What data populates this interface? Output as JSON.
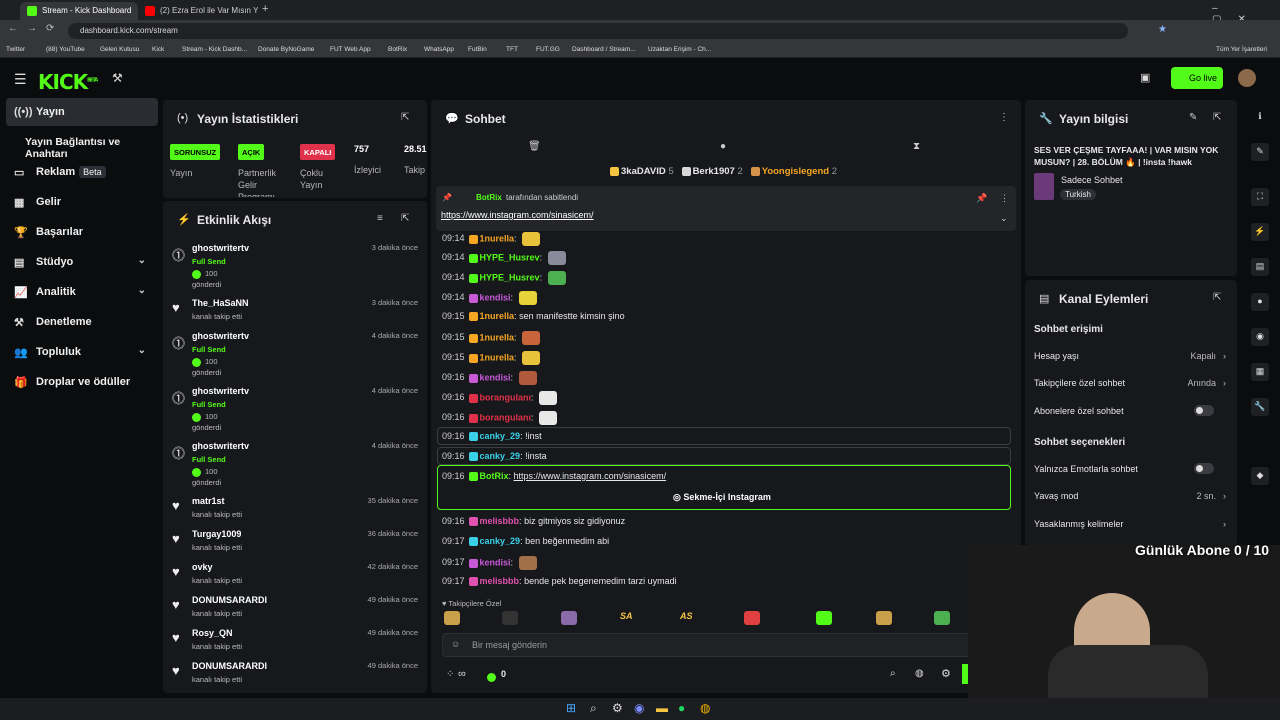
{
  "browser": {
    "tabs": [
      {
        "title": "Stream - Kick Dashboard",
        "active": true
      },
      {
        "title": "(2) Ezra Erol ile Var Mısın Yok M",
        "active": false
      }
    ],
    "url": "dashboard.kick.com/stream",
    "bookmarks": [
      "Twitter",
      "(88) YouTube",
      "Gelen Kutusu",
      "Kick",
      "Stream - Kick Dashb...",
      "Donate ByNoGame",
      "FUT Web App",
      "BotRix",
      "WhatsApp",
      "FutBin",
      "TFT",
      "FUT.GG",
      "Dashboard / Stream...",
      "Uzaktan Erişim - Ch...",
      "Tüm Yer İşaretleri"
    ]
  },
  "header": {
    "logo": "KICK",
    "logo_sup": "BETA",
    "go_live": "Go live"
  },
  "sidebar": {
    "items": [
      {
        "label": "Yayın",
        "icon": "broadcast-icon"
      },
      {
        "label": "Yayın Bağlantısı ve Anahtarı",
        "icon": ""
      },
      {
        "label": "Reklam",
        "icon": "ad-icon",
        "badge": "Beta"
      },
      {
        "label": "Gelir",
        "icon": "revenue-icon"
      },
      {
        "label": "Başarılar",
        "icon": "trophy-icon"
      },
      {
        "label": "Stüdyo",
        "icon": "studio-icon"
      },
      {
        "label": "Analitik",
        "icon": "analytics-icon"
      },
      {
        "label": "Denetleme",
        "icon": "moderation-icon"
      },
      {
        "label": "Topluluk",
        "icon": "community-icon"
      },
      {
        "label": "Droplar ve ödüller",
        "icon": "drops-icon"
      }
    ]
  },
  "stats": {
    "title": "Yayın İstatistikleri",
    "items": [
      {
        "badge": "SORUNSUZ",
        "label": "Yayın"
      },
      {
        "badge": "AÇIK",
        "label": "Partnerlik Gelir Programı"
      },
      {
        "badge": "KAPALI",
        "label": "Çoklu Yayın"
      },
      {
        "value": "757",
        "label": "İzleyici"
      },
      {
        "value": "28.51",
        "label": "Takip"
      }
    ]
  },
  "activity": {
    "title": "Etkinlik Akışı",
    "events": [
      {
        "user": "ghostwritertv",
        "time": "3 dakika önce",
        "type": "sub",
        "line1": "Full Send",
        "line2": "100",
        "line3": "gönderdi"
      },
      {
        "user": "The_HaSaNN",
        "time": "3 dakika önce",
        "type": "follow",
        "line1": "kanalı takip etti"
      },
      {
        "user": "ghostwritertv",
        "time": "4 dakika önce",
        "type": "sub",
        "line1": "Full Send",
        "line2": "100",
        "line3": "gönderdi"
      },
      {
        "user": "ghostwritertv",
        "time": "4 dakika önce",
        "type": "sub",
        "line1": "Full Send",
        "line2": "100",
        "line3": "gönderdi"
      },
      {
        "user": "ghostwritertv",
        "time": "4 dakika önce",
        "type": "sub",
        "line1": "Full Send",
        "line2": "100",
        "line3": "gönderdi"
      },
      {
        "user": "matr1st",
        "time": "35 dakika önce",
        "type": "follow",
        "line1": "kanalı takip etti"
      },
      {
        "user": "Turgay1009",
        "time": "36 dakika önce",
        "type": "follow",
        "line1": "kanalı takip etti"
      },
      {
        "user": "ovky",
        "time": "42 dakika önce",
        "type": "follow",
        "line1": "kanalı takip etti"
      },
      {
        "user": "DONUMSARARDI",
        "time": "49 dakika önce",
        "type": "follow",
        "line1": "kanalı takip etti"
      },
      {
        "user": "Rosy_QN",
        "time": "49 dakika önce",
        "type": "follow",
        "line1": "kanalı takip etti"
      },
      {
        "user": "DONUMSARARDI",
        "time": "49 dakika önce",
        "type": "follow",
        "line1": "kanalı takip etti"
      }
    ]
  },
  "chat": {
    "title": "Sohbet",
    "leaderboard": [
      {
        "name": "3kaDAVID",
        "count": "5",
        "color": "#f5c542"
      },
      {
        "name": "Berk1907",
        "count": "2",
        "color": "#d8d8d8"
      },
      {
        "name": "Yoongislegend",
        "count": "2",
        "color": "#d7924a"
      }
    ],
    "pinned": {
      "by": "BotRix",
      "by_suffix": "tarafından sabitlendi",
      "text": "https://www.instagram.com/sinasicem/"
    },
    "messages": [
      {
        "time": "09:14",
        "user": "1nurella",
        "color": "#f5a623",
        "text": "",
        "emote": "#e8c23a"
      },
      {
        "time": "09:14",
        "user": "HYPE_Husrev",
        "color": "#53fc18",
        "text": "",
        "emote": "#8a8a9a"
      },
      {
        "time": "09:14",
        "user": "HYPE_Husrev",
        "color": "#53fc18",
        "text": "",
        "emote": "#4caf50"
      },
      {
        "time": "09:14",
        "user": "kendisi",
        "color": "#c85ad8",
        "text": "",
        "emote": "#e8d23a"
      },
      {
        "time": "09:15",
        "user": "1nurella",
        "color": "#f5a623",
        "text": "sen manifestte kimsin şino",
        "emote": ""
      },
      {
        "time": "09:15",
        "user": "1nurella",
        "color": "#f5a623",
        "text": "",
        "emote": "#c8643c"
      },
      {
        "time": "09:15",
        "user": "1nurella",
        "color": "#f5a623",
        "text": "",
        "emote": "#e8c23a"
      },
      {
        "time": "09:16",
        "user": "kendisi",
        "color": "#c85ad8",
        "text": "",
        "emote": "#b05a3c"
      },
      {
        "time": "09:16",
        "user": "borangulanı",
        "color": "#e0324a",
        "text": "",
        "emote": "#e8e8e8"
      },
      {
        "time": "09:16",
        "user": "borangulanı",
        "color": "#e0324a",
        "text": "",
        "emote": "#e8e8e8"
      },
      {
        "time": "09:16",
        "user": "canky_29",
        "color": "#3ad0e8",
        "text": "!inst",
        "emote": ""
      },
      {
        "time": "09:16",
        "user": "canky_29",
        "color": "#3ad0e8",
        "text": "!insta",
        "emote": ""
      },
      {
        "time": "09:16",
        "user": "BotRix",
        "color": "#53fc18",
        "text": "https://www.instagram.com/sinasicem/",
        "emote": ""
      },
      {
        "time": "09:16",
        "user": "melisbbb",
        "color": "#e052b0",
        "text": "biz gitmiyos siz gidiyonuz",
        "emote": ""
      },
      {
        "time": "09:17",
        "user": "canky_29",
        "color": "#3ad0e8",
        "text": "ben beğenmedim abi",
        "emote": ""
      },
      {
        "time": "09:17",
        "user": "kendisi",
        "color": "#c85ad8",
        "text": "",
        "emote": "#a0704a"
      },
      {
        "time": "09:17",
        "user": "melisbbb",
        "color": "#e052b0",
        "text": "bende pek begenemedim tarzi uymadi",
        "emote": ""
      }
    ],
    "bot_button": "Sekme-İçi Instagram",
    "emote_section": "Takipçilere Özel",
    "emote_labels": [
      "SA",
      "AS"
    ],
    "input_placeholder": "Bir mesaj gönderin",
    "footer": {
      "viewers": "∞",
      "kicks": "0"
    }
  },
  "stream_info": {
    "title": "Yayın bilgisi",
    "stream_title": "SES VER ÇEŞME TAYFAAA! | VAR MISIN YOK MUSUN? | 28. BÖLÜM 🔥 | !insta !hawk",
    "category": "Sadece Sohbet",
    "tag": "Turkish"
  },
  "channel_actions": {
    "title": "Kanal Eylemleri",
    "access_heading": "Sohbet erişimi",
    "rows": [
      {
        "label": "Hesap yaşı",
        "value": "Kapalı",
        "kind": "link"
      },
      {
        "label": "Takipçilere özel sohbet",
        "value": "Anında",
        "kind": "link",
        "accent": true
      },
      {
        "label": "Abonelere özel sohbet",
        "value": "",
        "kind": "toggle"
      }
    ],
    "options_heading": "Sohbet seçenekleri",
    "rows2": [
      {
        "label": "Yalnızca Emotlarla sohbet",
        "value": "",
        "kind": "toggle"
      },
      {
        "label": "Yavaş mod",
        "value": "2 sn.",
        "kind": "link",
        "accent": true
      },
      {
        "label": "Yasaklanmış kelimeler",
        "value": "",
        "kind": "link"
      }
    ]
  },
  "overlay": {
    "sub_goal": "Günlük Abone 0 / 10"
  },
  "colors": {
    "accent": "#53fc18",
    "bg": "#0b0c0e",
    "panel": "#17181b"
  }
}
